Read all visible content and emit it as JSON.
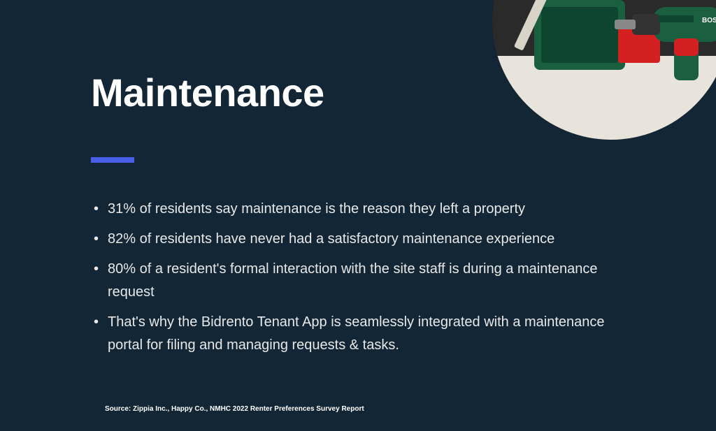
{
  "title": "Maintenance",
  "accent_color": "#4a5fe8",
  "bullets": [
    "31% of residents say maintenance is the reason they left a property",
    "82% of residents have never had a satisfactory maintenance experience",
    "80% of a resident's formal interaction with the site staff is during a maintenance request",
    "That's why the Bidrento Tenant App is seamlessly integrated with a maintenance portal for filing and managing requests & tasks."
  ],
  "source": "Source: Zippia Inc., Happy Co., NMHC 2022 Renter Preferences Survey Report"
}
